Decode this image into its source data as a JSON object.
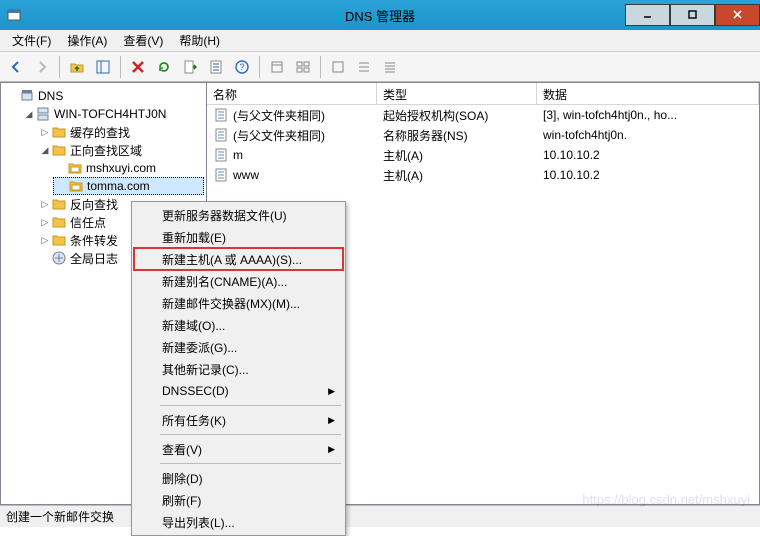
{
  "title": "DNS 管理器",
  "menu": {
    "file": "文件(F)",
    "action": "操作(A)",
    "view": "查看(V)",
    "help": "帮助(H)"
  },
  "tree": {
    "root": "DNS",
    "server": "WIN-TOFCH4HTJ0N",
    "nodes": {
      "cache": "缓存的查找",
      "fwd": "正向查找区域",
      "zone1": "mshxuyi.com",
      "zone2": "tomma.com",
      "rev": "反向查找",
      "trust": "信任点",
      "cond": "条件转发",
      "global": "全局日志"
    }
  },
  "columns": {
    "name": "名称",
    "type": "类型",
    "data": "数据"
  },
  "records": [
    {
      "name": "(与父文件夹相同)",
      "type": "起始授权机构(SOA)",
      "data": "[3], win-tofch4htj0n., ho..."
    },
    {
      "name": "(与父文件夹相同)",
      "type": "名称服务器(NS)",
      "data": "win-tofch4htj0n."
    },
    {
      "name": "m",
      "type": "主机(A)",
      "data": "10.10.10.2"
    },
    {
      "name": "www",
      "type": "主机(A)",
      "data": "10.10.10.2"
    }
  ],
  "ctx": {
    "update": "更新服务器数据文件(U)",
    "reload": "重新加载(E)",
    "newa": "新建主机(A 或 AAAA)(S)...",
    "newcname": "新建别名(CNAME)(A)...",
    "newmx": "新建邮件交换器(MX)(M)...",
    "newdomain": "新建域(O)...",
    "newdeleg": "新建委派(G)...",
    "other": "其他新记录(C)...",
    "dnssec": "DNSSEC(D)",
    "alltasks": "所有任务(K)",
    "view": "查看(V)",
    "delete": "删除(D)",
    "refresh": "刷新(F)",
    "export": "导出列表(L)..."
  },
  "status": "创建一个新邮件交换",
  "watermark": "https://blog.csdn.net/mshxuyi"
}
